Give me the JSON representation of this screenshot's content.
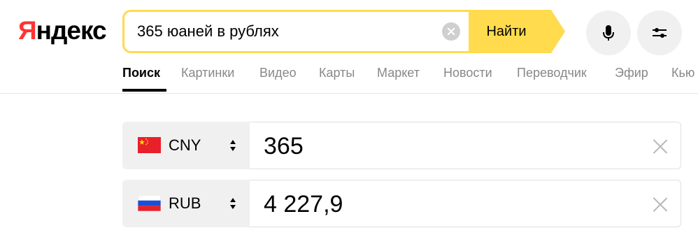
{
  "logo": {
    "first_letter": "Я",
    "rest": "ндекс"
  },
  "search": {
    "query": "365 юаней в рублях",
    "button_label": "Найти"
  },
  "tabs": [
    {
      "label": "Поиск",
      "active": true
    },
    {
      "label": "Картинки",
      "active": false
    },
    {
      "label": "Видео",
      "active": false
    },
    {
      "label": "Карты",
      "active": false
    },
    {
      "label": "Маркет",
      "active": false
    },
    {
      "label": "Новости",
      "active": false
    },
    {
      "label": "Переводчик",
      "active": false
    },
    {
      "label": "Эфир",
      "active": false
    },
    {
      "label": "Кью",
      "active": false
    }
  ],
  "converter": {
    "from": {
      "code": "CNY",
      "flag": "cn-flag-icon",
      "amount": "365"
    },
    "to": {
      "code": "RUB",
      "flag": "ru-flag-icon",
      "amount": "4 227,9"
    }
  },
  "colors": {
    "accent_yellow": "#ffdb4d",
    "logo_red": "#ff3333",
    "tab_inactive": "#888888"
  }
}
